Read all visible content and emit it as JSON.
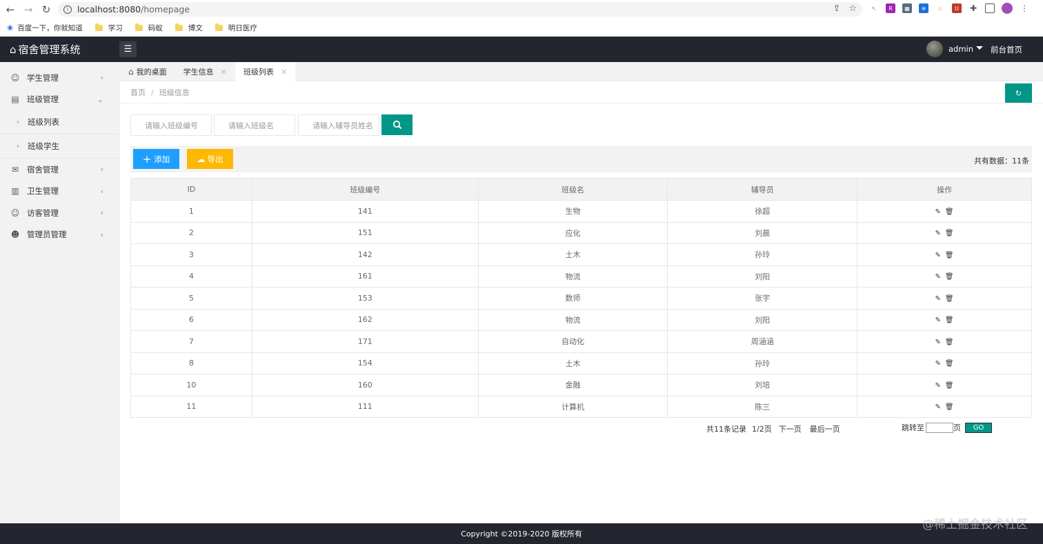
{
  "browser": {
    "url_host": "localhost:8080",
    "url_path": "/homepage",
    "bookmarks": [
      "百度一下，你就知道",
      "学习",
      "码蚁",
      "博文",
      "明日医疗"
    ]
  },
  "header": {
    "app_title": "宿舍管理系统",
    "username": "admin",
    "front_link": "前台首页"
  },
  "sidebar": {
    "items": [
      {
        "label": "学生管理"
      },
      {
        "label": "班级管理"
      },
      {
        "label": "班级列表"
      },
      {
        "label": "班级学生"
      },
      {
        "label": "宿舍管理"
      },
      {
        "label": "卫生管理"
      },
      {
        "label": "访客管理"
      },
      {
        "label": "管理员管理"
      }
    ]
  },
  "tabs": [
    {
      "label": "我的桌面"
    },
    {
      "label": "学生信息"
    },
    {
      "label": "班级列表"
    }
  ],
  "breadcrumb": {
    "home": "首页",
    "sep": "/",
    "current": "班级信息"
  },
  "search": {
    "class_no_placeholder": "请输入班级编号",
    "class_name_placeholder": "请输入班级名",
    "counselor_placeholder": "请输入辅导员姓名"
  },
  "toolbar": {
    "add_label": "添加",
    "export_label": "导出",
    "total_text": "共有数据：11条"
  },
  "table": {
    "headers": [
      "ID",
      "班级编号",
      "班级名",
      "辅导员",
      "操作"
    ],
    "rows": [
      {
        "id": "1",
        "no": "141",
        "name": "生物",
        "counselor": "徐超"
      },
      {
        "id": "2",
        "no": "151",
        "name": "应化",
        "counselor": "刘晨"
      },
      {
        "id": "3",
        "no": "142",
        "name": "土木",
        "counselor": "孙玲"
      },
      {
        "id": "4",
        "no": "161",
        "name": "物流",
        "counselor": "刘阳"
      },
      {
        "id": "5",
        "no": "153",
        "name": "数师",
        "counselor": "张宇"
      },
      {
        "id": "6",
        "no": "162",
        "name": "物流",
        "counselor": "刘阳"
      },
      {
        "id": "7",
        "no": "171",
        "name": "自动化",
        "counselor": "周涵涵"
      },
      {
        "id": "8",
        "no": "154",
        "name": "土木",
        "counselor": "孙玲"
      },
      {
        "id": "10",
        "no": "160",
        "name": "金融",
        "counselor": "刘培"
      },
      {
        "id": "11",
        "no": "111",
        "name": "计算机",
        "counselor": "陈三"
      }
    ]
  },
  "pager": {
    "records": "共11条记录",
    "page": "1/2页",
    "next": "下一页",
    "last": "最后一页",
    "jump_label": "跳转至",
    "page_unit": "页",
    "go": "GO"
  },
  "footer": {
    "copyright": "Copyright ©2019-2020 版权所有",
    "watermark": "@稀土掘金技术社区"
  },
  "colors": {
    "header_bg": "#23262e",
    "primary": "#009688",
    "blue": "#1e9fff",
    "orange": "#ffb800"
  }
}
